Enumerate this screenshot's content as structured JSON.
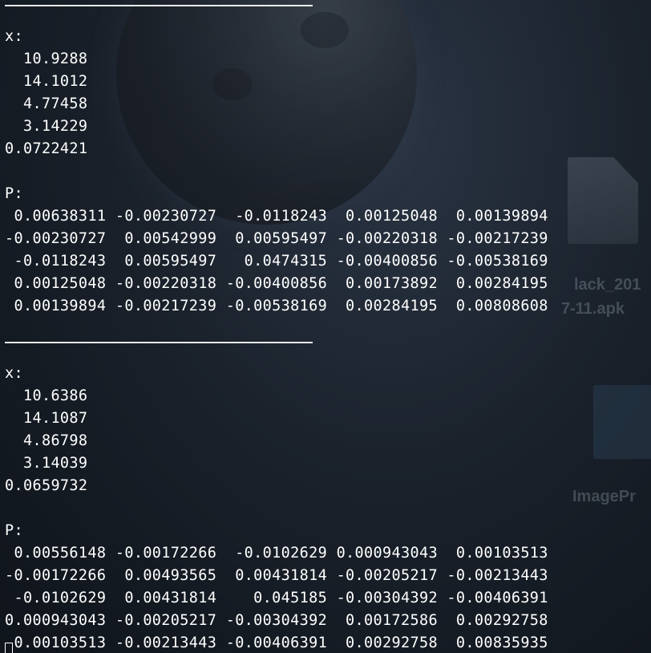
{
  "desktop": {
    "file_label_line1": "lack_201",
    "file_label_line2": "7-11.apk",
    "folder_label": "ImagePr"
  },
  "terminal": {
    "lines": [
      "",
      "x:",
      "  10.9288",
      "  14.1012",
      "  4.77458",
      "  3.14229",
      "0.0722421",
      "",
      "P:",
      " 0.00638311 -0.00230727  -0.0118243  0.00125048  0.00139894",
      "-0.00230727  0.00542999  0.00595497 -0.00220318 -0.00217239",
      " -0.0118243  0.00595497   0.0474315 -0.00400856 -0.00538169",
      " 0.00125048 -0.00220318 -0.00400856  0.00173892  0.00284195",
      " 0.00139894 -0.00217239 -0.00538169  0.00284195  0.00808608",
      "",
      "",
      "x:",
      "  10.6386",
      "  14.1087",
      "  4.86798",
      "  3.14039",
      "0.0659732",
      "",
      "P:",
      " 0.00556148 -0.00172266  -0.0102629 0.000943043  0.00103513",
      "-0.00172266  0.00493565  0.00431814 -0.00205217 -0.00213443",
      " -0.0102629  0.00431814    0.045185 -0.00304392 -0.00406391",
      "0.000943043 -0.00205217 -0.00304392  0.00172586  0.00292758",
      " 0.00103513 -0.00213443 -0.00406391  0.00292758  0.00835935"
    ],
    "separator_rows": [
      0,
      15
    ]
  }
}
